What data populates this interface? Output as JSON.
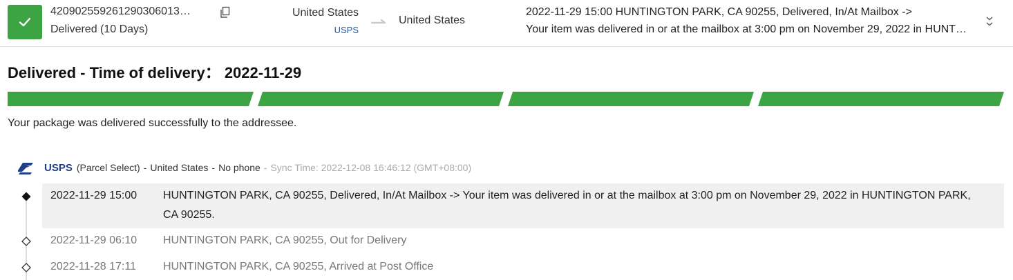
{
  "header": {
    "tracking_number": "420902559261290306013…",
    "status": "Delivered (10 Days)",
    "origin_country": "United States",
    "carrier": "USPS",
    "destination_country": "United States",
    "latest_event_line1": "2022-11-29 15:00  HUNTINGTON PARK, CA 90255, Delivered, In/At Mailbox ->",
    "latest_event_line2": "Your item was delivered in or at the mailbox at 3:00 pm on November 29, 2022 in HUNTINGTON PARK, CA 90255."
  },
  "summary": {
    "heading": "Delivered - Time of delivery： 2022-11-29",
    "progress_segments": 4,
    "progress_complete": 4,
    "progress_color": "#3da443",
    "note": "Your package was delivered successfully to the addressee."
  },
  "carrier_info": {
    "logo_icon": "usps-eagle-icon",
    "name": "USPS",
    "service": "(Parcel Select)",
    "sep1": "-",
    "country": "United States",
    "sep2": "-",
    "phone": "No phone",
    "sep3": "-",
    "sync_time": "Sync Time: 2022-12-08 16:46:12 (GMT+08:00)"
  },
  "events": [
    {
      "time": "2022-11-29 15:00",
      "description": "HUNTINGTON PARK, CA 90255, Delivered, In/At Mailbox -> Your item was delivered in or at the mailbox at 3:00 pm on November 29, 2022 in HUNTINGTON PARK, CA 90255."
    },
    {
      "time": "2022-11-29 06:10",
      "description": "HUNTINGTON PARK, CA 90255, Out for Delivery"
    },
    {
      "time": "2022-11-28 17:11",
      "description": "HUNTINGTON PARK, CA 90255, Arrived at Post Office"
    }
  ],
  "colors": {
    "accent_green": "#3da443",
    "carrier_blue": "#1e3f8a",
    "link_blue": "#1a5fb4"
  }
}
